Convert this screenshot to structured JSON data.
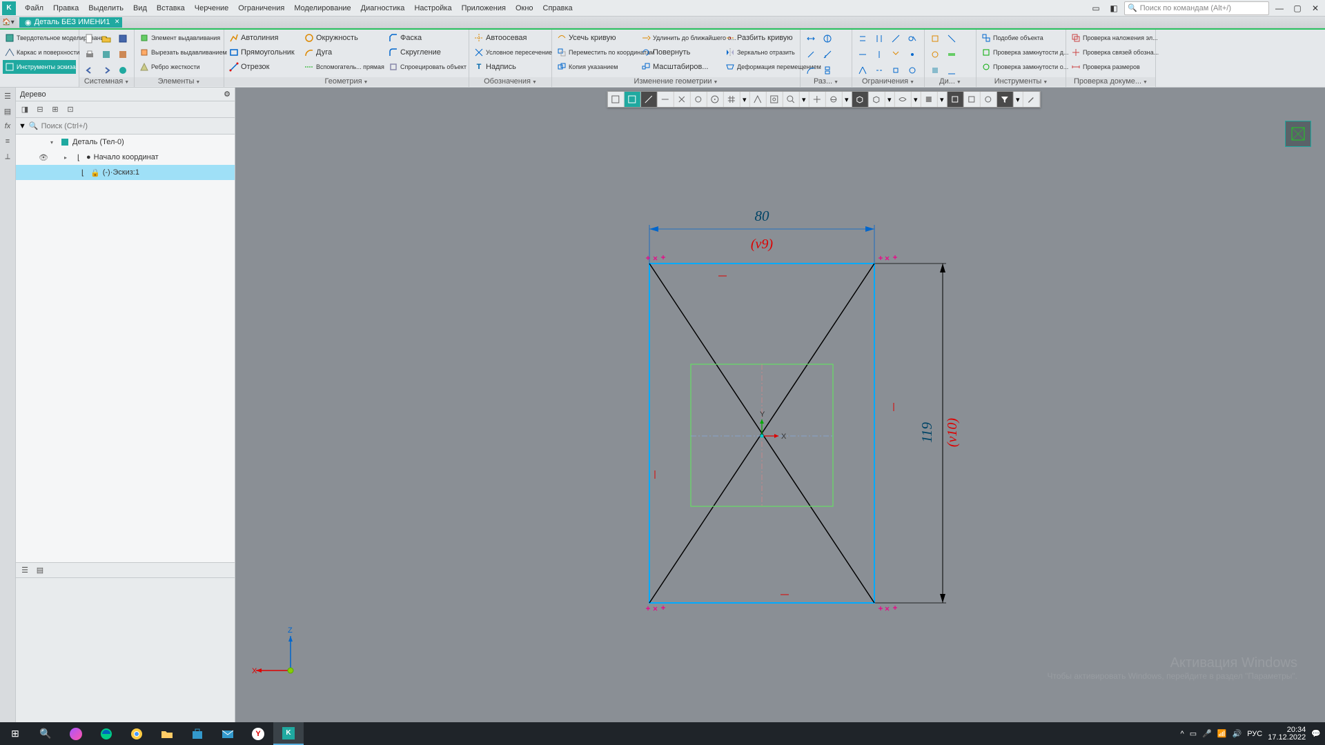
{
  "menu": {
    "items": [
      "Файл",
      "Правка",
      "Выделить",
      "Вид",
      "Вставка",
      "Черчение",
      "Ограничения",
      "Моделирование",
      "Диагностика",
      "Настройка",
      "Приложения",
      "Окно",
      "Справка"
    ]
  },
  "search": {
    "placeholder": "Поиск по командам (Alt+/)"
  },
  "tab": {
    "title": "Деталь БЕЗ ИМЕНИ1"
  },
  "ribbon": {
    "g1": {
      "title": "",
      "items": [
        "Твердотельное моделирование",
        "Каркас и поверхности",
        "Инструменты эскиза"
      ]
    },
    "g2": {
      "title": "Системная"
    },
    "g3": {
      "title": "Элементы",
      "items": [
        "Элемент выдавливания",
        "Вырезать выдавливанием",
        "Ребро жесткости"
      ]
    },
    "g4": {
      "title": "Геометрия",
      "r1": [
        "Автолиния",
        "Окружность",
        "Фаска"
      ],
      "r2": [
        "Прямоугольник",
        "Дуга",
        "Скругление"
      ],
      "r3": [
        "Отрезок",
        "Вспомогатель... прямая",
        "Спроецировать объект"
      ]
    },
    "g5": {
      "title": "Обозначения",
      "items": [
        "Автоосевая",
        "Условное пересечение",
        "Надпись"
      ]
    },
    "g6": {
      "title": "Изменение геометрии",
      "r1": [
        "Усечь кривую",
        "Удлинить до ближайшего о...",
        "Разбить кривую"
      ],
      "r2": [
        "Переместить по координатам",
        "Повернуть",
        "Зеркально отразить"
      ],
      "r3": [
        "Копия указанием",
        "Масштабиров...",
        "Деформация перемещением"
      ]
    },
    "g7": {
      "title": "Раз..."
    },
    "g8": {
      "title": "Ограничения"
    },
    "g9": {
      "title": "Ди..."
    },
    "g10": {
      "title": "Инструменты",
      "items": [
        "Подобие объекта",
        "Проверка замкнутости д...",
        "Проверка замкнутости о..."
      ]
    },
    "g11": {
      "title": "Проверка докуме...",
      "items": [
        "Проверка наложения эл...",
        "Проверка связей обозна...",
        "Проверка размеров"
      ]
    }
  },
  "tree": {
    "title": "Дерево",
    "search_ph": "Поиск (Ctrl+/)",
    "rows": [
      "Деталь (Тел-0)",
      "Начало координат",
      "(-)·Эскиз:1"
    ]
  },
  "dims": {
    "w": "80",
    "wvar": "(v9)",
    "h": "119",
    "hvar": "(v10)"
  },
  "axes": {
    "x": "X",
    "y": "Y",
    "z": "Z"
  },
  "watermark": {
    "l1": "Активация Windows",
    "l2": "Чтобы активировать Windows, перейдите в раздел \"Параметры\"."
  },
  "tray": {
    "lang": "РУС",
    "time": "20:34",
    "date": "17.12.2022"
  }
}
